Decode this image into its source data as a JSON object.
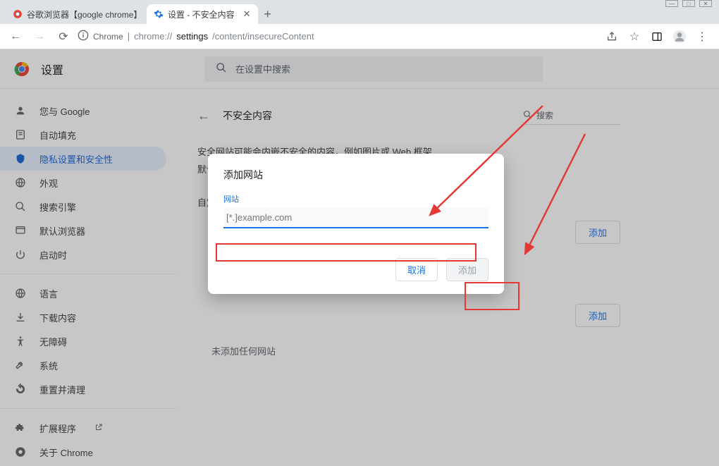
{
  "window": {
    "tabs": [
      {
        "title": "谷歌浏览器【google chrome】",
        "active": false
      },
      {
        "title": "设置 - 不安全内容",
        "active": true
      }
    ]
  },
  "toolbar": {
    "url_prefix": "Chrome",
    "url_sep": " | ",
    "url_host": "chrome://",
    "url_dark": "settings",
    "url_rest": "/content/insecureContent"
  },
  "settings": {
    "title": "设置",
    "search_placeholder": "在设置中搜索"
  },
  "sidebar": {
    "items": [
      {
        "icon": "person",
        "label": "您与 Google"
      },
      {
        "icon": "autofill",
        "label": "自动填充"
      },
      {
        "icon": "shield",
        "label": "隐私设置和安全性",
        "active": true
      },
      {
        "icon": "globe",
        "label": "外观"
      },
      {
        "icon": "search",
        "label": "搜索引擎"
      },
      {
        "icon": "browser",
        "label": "默认浏览器"
      },
      {
        "icon": "power",
        "label": "启动时"
      }
    ],
    "items2": [
      {
        "icon": "globe",
        "label": "语言"
      },
      {
        "icon": "download",
        "label": "下载内容"
      },
      {
        "icon": "accessibility",
        "label": "无障碍"
      },
      {
        "icon": "wrench",
        "label": "系统"
      },
      {
        "icon": "reset",
        "label": "重置并清理"
      }
    ],
    "items3": [
      {
        "icon": "extension",
        "label": "扩展程序",
        "external": true
      },
      {
        "icon": "chrome",
        "label": "关于 Chrome"
      }
    ]
  },
  "content": {
    "header_title": "不安全内容",
    "header_search": "搜索",
    "desc_line1": "安全网站可能会内嵌不安全的内容，例如图片或 Web 框架",
    "desc_line2": "默认情况下，安全网站会拦截不安全内容",
    "custom_label": "自定义的行为",
    "add_label": "添加",
    "empty_label": "未添加任何网站"
  },
  "dialog": {
    "title": "添加网站",
    "field_label": "网站",
    "placeholder": "[*.]example.com",
    "cancel": "取消",
    "confirm": "添加"
  }
}
